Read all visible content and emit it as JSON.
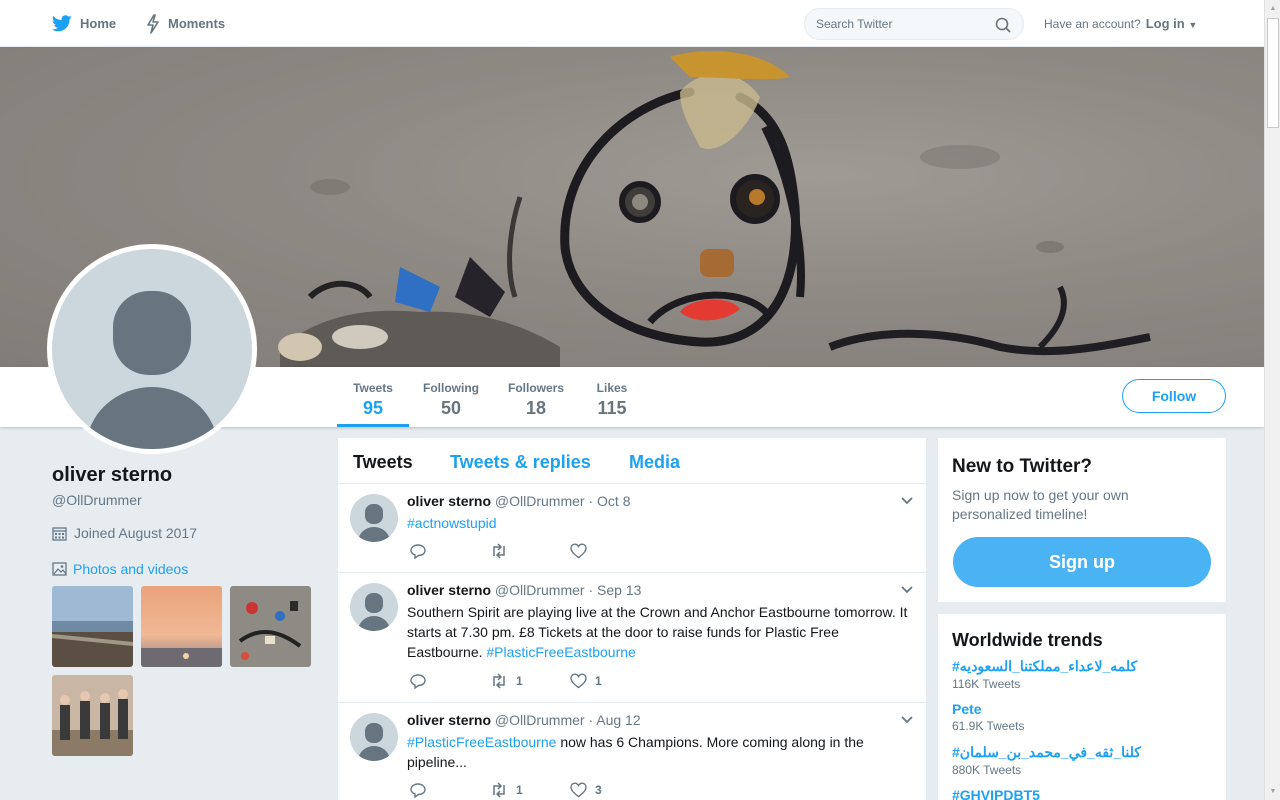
{
  "nav": {
    "home_label": "Home",
    "moments_label": "Moments",
    "search_placeholder": "Search Twitter",
    "account_prompt": "Have an account?",
    "login_label": "Log in"
  },
  "profile": {
    "name": "oliver sterno",
    "handle": "@OllDrummer",
    "joined": "Joined August 2017",
    "photos_label": "Photos and videos",
    "follow_label": "Follow",
    "stats": [
      {
        "label": "Tweets",
        "value": "95"
      },
      {
        "label": "Following",
        "value": "50"
      },
      {
        "label": "Followers",
        "value": "18"
      },
      {
        "label": "Likes",
        "value": "115"
      }
    ]
  },
  "timeline": {
    "tabs": [
      "Tweets",
      "Tweets & replies",
      "Media"
    ],
    "tweets": [
      {
        "name": "oliver sterno",
        "handle": "@OllDrummer",
        "date": "· Oct 8",
        "hashtag": "#actnowstupid",
        "text_after": "",
        "retweets": "",
        "likes": ""
      },
      {
        "name": "oliver sterno",
        "handle": "@OllDrummer",
        "date": "· Sep 13",
        "text_before": "Southern Spirit are playing live at the Crown and Anchor Eastbourne tomorrow. It starts at 7.30 pm. £8 Tickets at the door to raise funds for Plastic Free Eastbourne.",
        "hashtag": "#PlasticFreeEastbourne",
        "retweets": "1",
        "likes": "1"
      },
      {
        "name": "oliver sterno",
        "handle": "@OllDrummer",
        "date": "· Aug 12",
        "hashtag": "#PlasticFreeEastbourne",
        "text_after": "now has 6 Champions. More coming along in the pipeline...",
        "retweets": "1",
        "likes": "3"
      }
    ]
  },
  "sidebar": {
    "signup_title": "New to Twitter?",
    "signup_text": "Sign up now to get your own personalized timeline!",
    "signup_button": "Sign up",
    "trends_title": "Worldwide trends",
    "trends": [
      {
        "name": "#كلمه_لاعداء_مملكتنا_السعوديه",
        "count": "116K Tweets"
      },
      {
        "name": "Pete",
        "count": "61.9K Tweets"
      },
      {
        "name": "#كلنا_ثقه_في_محمد_بن_سلمان",
        "count": "880K Tweets"
      },
      {
        "name": "#GHVIPDBT5",
        "count": ""
      }
    ]
  },
  "colors": {
    "accent": "#1da1f2",
    "background": "#e6ecf0",
    "signup_button": "#4ab3f4"
  }
}
